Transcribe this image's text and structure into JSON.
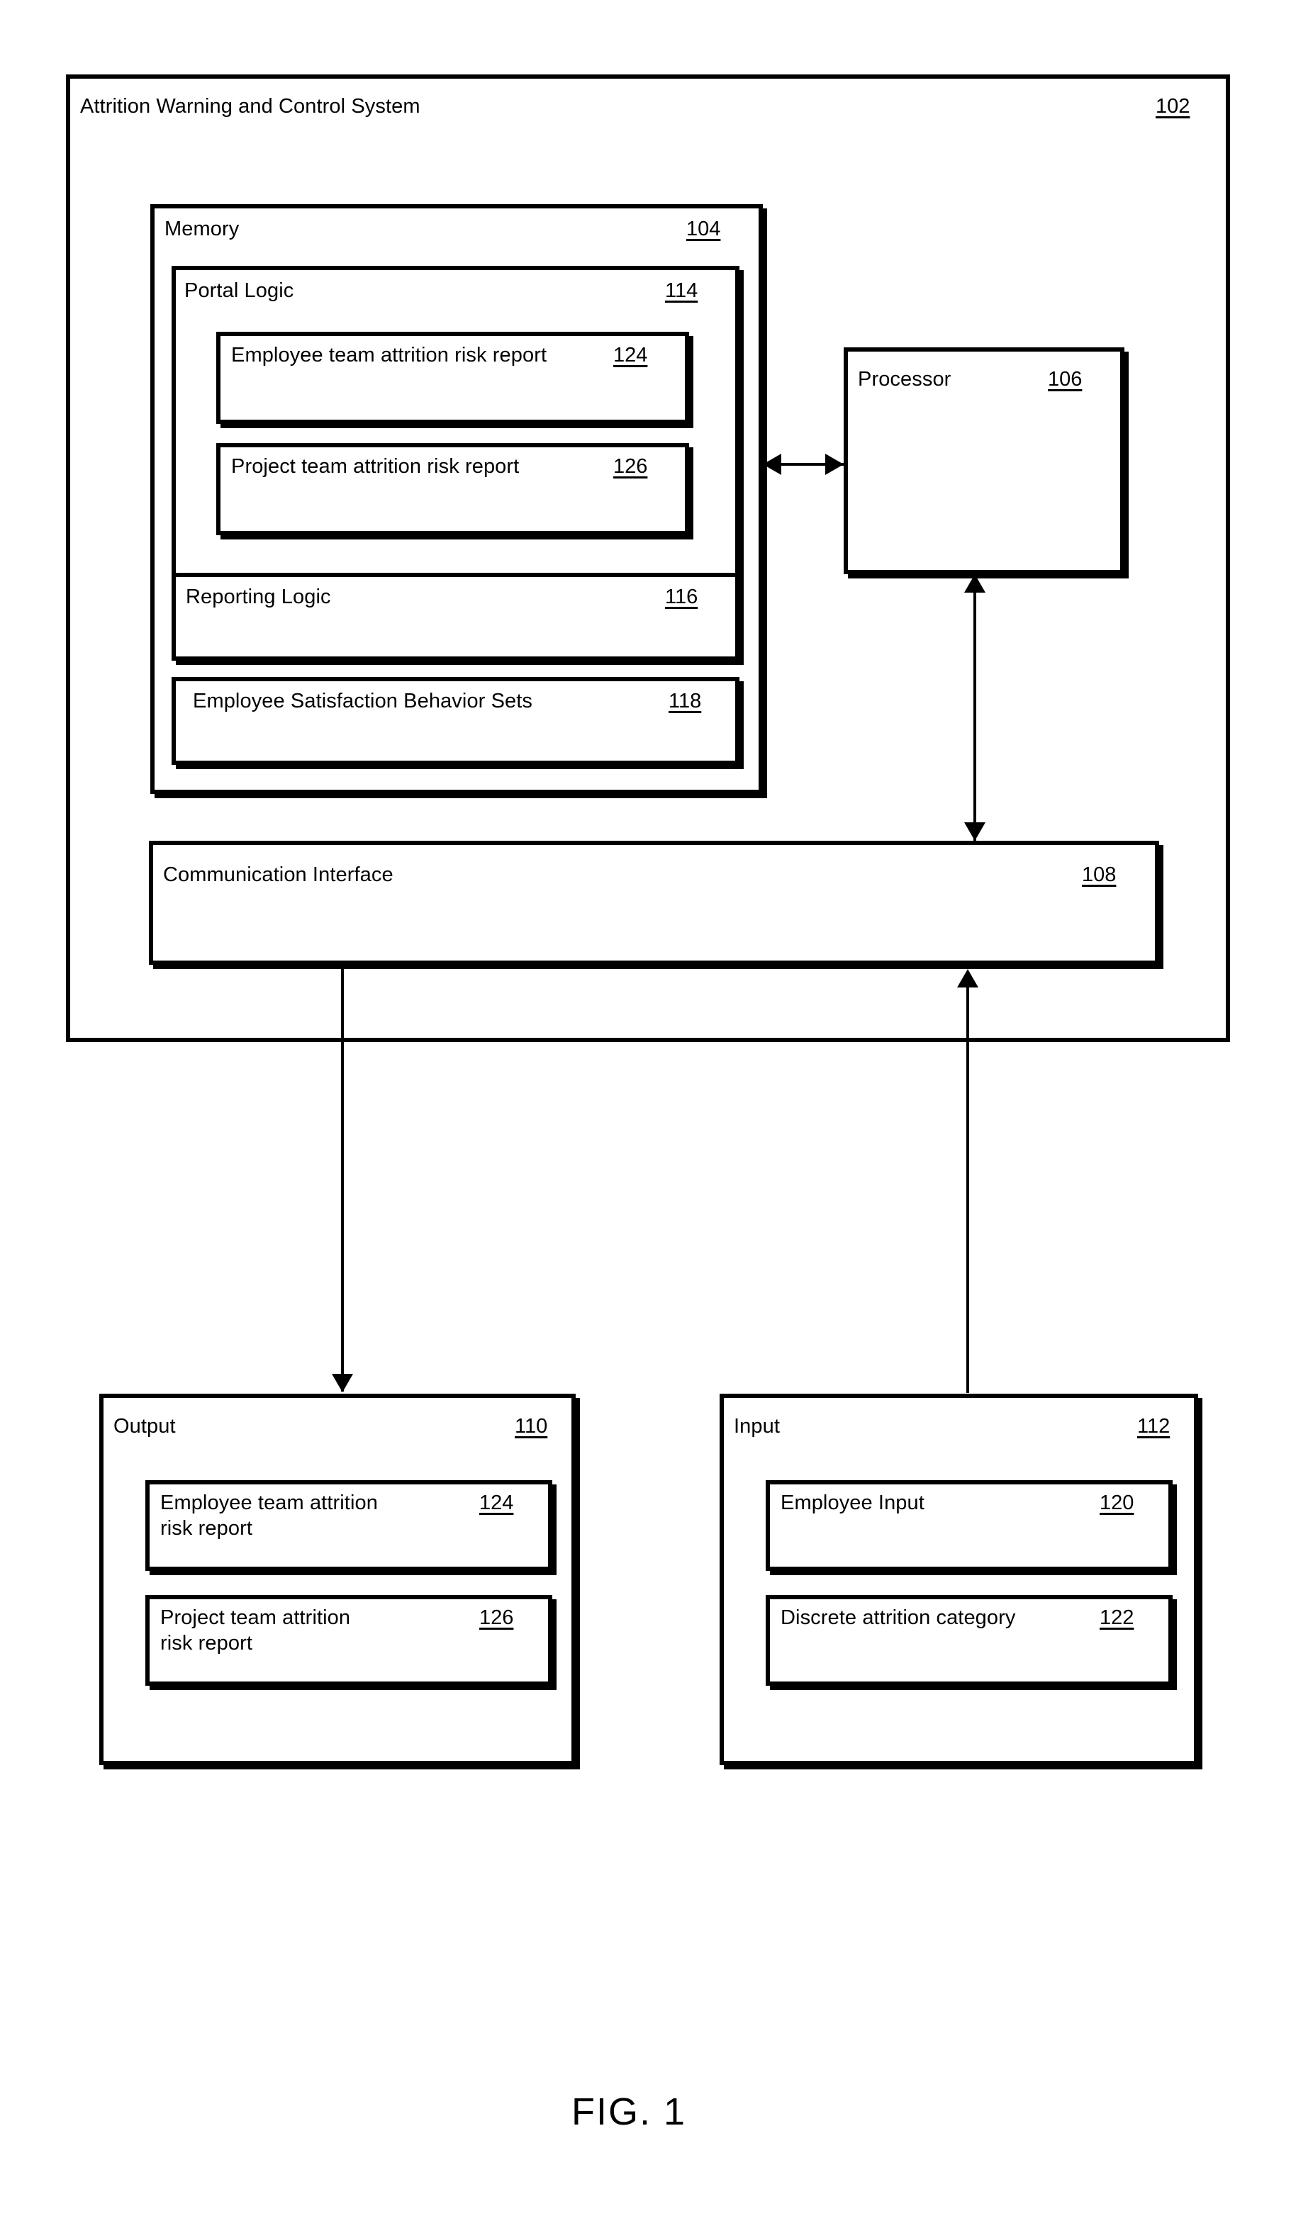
{
  "figure": {
    "caption": "FIG. 1"
  },
  "system": {
    "title": "Attrition Warning and Control System",
    "ref": "102"
  },
  "memory": {
    "title": "Memory",
    "ref": "104",
    "portal_logic": {
      "title": "Portal Logic",
      "ref": "114",
      "items": [
        {
          "label": "Employee team attrition risk report",
          "ref": "124"
        },
        {
          "label": "Project team attrition risk report",
          "ref": "126"
        }
      ]
    },
    "reporting_logic": {
      "title": "Reporting Logic",
      "ref": "116"
    },
    "behavior_sets": {
      "title": "Employee Satisfaction Behavior Sets",
      "ref": "118"
    }
  },
  "processor": {
    "title": "Processor",
    "ref": "106"
  },
  "communication_interface": {
    "title": "Communication Interface",
    "ref": "108"
  },
  "output": {
    "title": "Output",
    "ref": "110",
    "items": [
      {
        "label": "Employee team attrition\nrisk report",
        "ref": "124"
      },
      {
        "label": "Project team attrition\nrisk report",
        "ref": "126"
      }
    ]
  },
  "input": {
    "title": "Input",
    "ref": "112",
    "items": [
      {
        "label": "Employee Input",
        "ref": "120"
      },
      {
        "label": "Discrete attrition category",
        "ref": "122"
      }
    ]
  },
  "connectors": [
    {
      "name": "memory-processor",
      "type": "bidirectional-horizontal"
    },
    {
      "name": "processor-communication-interface",
      "type": "bidirectional-vertical"
    },
    {
      "name": "communication-interface-output",
      "type": "down"
    },
    {
      "name": "input-communication-interface",
      "type": "up"
    }
  ]
}
